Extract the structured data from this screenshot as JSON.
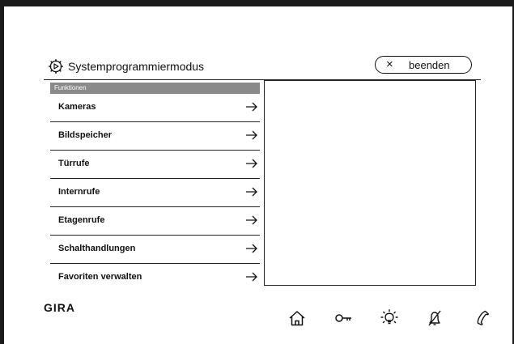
{
  "header": {
    "title": "Systemprogrammiermodus",
    "end_button": {
      "close_symbol": "×",
      "label": "beenden"
    }
  },
  "menu": {
    "section_label": "Funktionen",
    "items": [
      {
        "label": "Kameras"
      },
      {
        "label": "Bildspeicher"
      },
      {
        "label": "Türrufe"
      },
      {
        "label": "Internrufe"
      },
      {
        "label": "Etagenrufe"
      },
      {
        "label": "Schalthandlungen"
      },
      {
        "label": "Favoriten verwalten"
      }
    ]
  },
  "brand": "GIRA",
  "footer_icons": [
    "home-icon",
    "key-icon",
    "light-icon",
    "bell-muted-icon",
    "phone-icon"
  ]
}
